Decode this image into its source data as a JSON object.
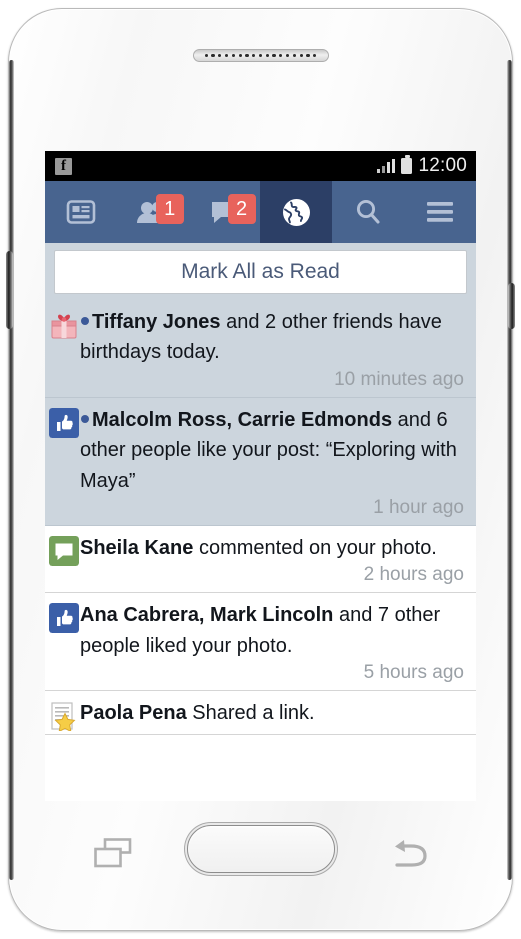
{
  "device": {
    "speaker_dots": 17,
    "home_button_name": "home-button",
    "recent_apps_name": "recent-apps-button",
    "back_name": "back-button"
  },
  "status_bar": {
    "app_logo": "facebook-logo",
    "logo_letter": "f",
    "signal_icon": "signal-bars-icon",
    "battery_icon": "battery-icon",
    "time": "12:00"
  },
  "app_nav": {
    "background_color": "#48648f",
    "active_color": "#2c3f66",
    "badge_color": "#e8635c",
    "items": [
      {
        "name": "newsfeed",
        "icon": "newsfeed-icon",
        "badge": "",
        "active": false
      },
      {
        "name": "friend-requests",
        "icon": "friends-icon",
        "badge": "1",
        "active": false
      },
      {
        "name": "messages",
        "icon": "messages-icon",
        "badge": "2",
        "active": false
      },
      {
        "name": "notifications",
        "icon": "globe-icon",
        "badge": "",
        "active": true
      },
      {
        "name": "search",
        "icon": "search-icon",
        "badge": "",
        "active": false
      },
      {
        "name": "more",
        "icon": "hamburger-menu-icon",
        "badge": "",
        "active": false
      }
    ]
  },
  "toolbar": {
    "mark_all_label": "Mark All as Read"
  },
  "notifications": [
    {
      "icon": "gift-icon",
      "unread": true,
      "has_dot": true,
      "bold": "Tiffany Jones",
      "rest": " and 2 other friends have birthdays today.",
      "time": "10 minutes ago"
    },
    {
      "icon": "thumbs-up-icon",
      "unread": true,
      "has_dot": true,
      "bold": "Malcolm Ross, Carrie Edmonds",
      "rest": " and 6 other people like your post: “Exploring with Maya”",
      "time": "1 hour ago"
    },
    {
      "icon": "comment-icon",
      "unread": false,
      "has_dot": false,
      "bold": "Sheila Kane",
      "rest": " commented on your photo.",
      "time": "2 hours ago"
    },
    {
      "icon": "thumbs-up-icon",
      "unread": false,
      "has_dot": false,
      "bold": "Ana Cabrera, Mark Lincoln",
      "rest": " and 7 other people liked your photo.",
      "time": "5 hours ago"
    },
    {
      "icon": "shared-link-star-icon",
      "unread": false,
      "has_dot": false,
      "bold": "Paola Pena",
      "rest": " Shared a link.",
      "time": ""
    }
  ]
}
